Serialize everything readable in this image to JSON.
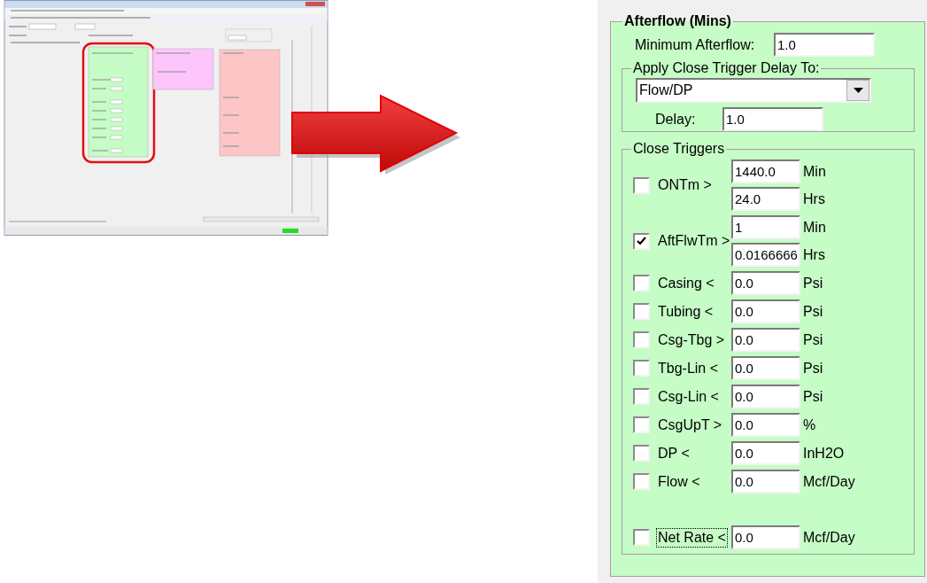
{
  "afterflow": {
    "title": "Afterflow (Mins)",
    "minimum_afterflow": {
      "label": "Minimum Afterflow:",
      "value": "1.0"
    },
    "delay_group": {
      "title": "Apply Close Trigger Delay To:",
      "dropdown": {
        "value": "Flow/DP"
      },
      "delay": {
        "label": "Delay:",
        "value": "1.0"
      }
    },
    "close_triggers": {
      "title": "Close Triggers",
      "triggers": [
        {
          "label": "ONTm >",
          "checked": false,
          "fields": [
            {
              "value": "1440.0",
              "unit": "Min"
            },
            {
              "value": "24.0",
              "unit": "Hrs"
            }
          ]
        },
        {
          "label": "AftFlwTm >",
          "checked": true,
          "fields": [
            {
              "value": "1",
              "unit": "Min"
            },
            {
              "value": "0.0166666",
              "unit": "Hrs"
            }
          ]
        },
        {
          "label": "Casing <",
          "checked": false,
          "fields": [
            {
              "value": "0.0",
              "unit": "Psi"
            }
          ]
        },
        {
          "label": "Tubing <",
          "checked": false,
          "fields": [
            {
              "value": "0.0",
              "unit": "Psi"
            }
          ]
        },
        {
          "label": "Csg-Tbg >",
          "checked": false,
          "fields": [
            {
              "value": "0.0",
              "unit": "Psi"
            }
          ]
        },
        {
          "label": "Tbg-Lin <",
          "checked": false,
          "fields": [
            {
              "value": "0.0",
              "unit": "Psi"
            }
          ]
        },
        {
          "label": "Csg-Lin <",
          "checked": false,
          "fields": [
            {
              "value": "0.0",
              "unit": "Psi"
            }
          ]
        },
        {
          "label": "CsgUpT >",
          "checked": false,
          "fields": [
            {
              "value": "0.0",
              "unit": "%"
            }
          ]
        },
        {
          "label": "DP <",
          "checked": false,
          "fields": [
            {
              "value": "0.0",
              "unit": "InH2O"
            }
          ]
        },
        {
          "label": "Flow <",
          "checked": false,
          "fields": [
            {
              "value": "0.0",
              "unit": "Mcf/Day"
            }
          ]
        }
      ],
      "net_rate": {
        "label": "Net Rate <",
        "checked": false,
        "focused": true,
        "fields": [
          {
            "value": "0.0",
            "unit": "Mcf/Day"
          }
        ]
      }
    }
  }
}
